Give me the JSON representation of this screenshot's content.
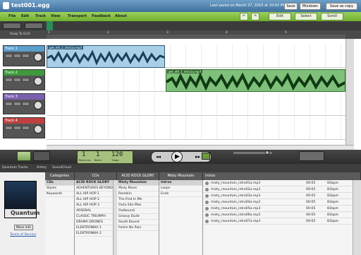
{
  "window": {
    "title": "test001.egg",
    "last_saved": "Last saved on March 27, 2010 at 10:42 PM"
  },
  "window_buttons": {
    "save": "Save",
    "mixdown": "Mixdown",
    "save_as_copy": "Save as copy"
  },
  "menu": {
    "items": [
      "File",
      "Edit",
      "Track",
      "View",
      "Transport",
      "Feedback",
      "About"
    ],
    "edit": "Edit",
    "select": "Select",
    "scroll": "Scroll"
  },
  "ruler": {
    "snap": "Snap To Grid",
    "marks": [
      "1",
      "2",
      "3",
      "4",
      "5"
    ]
  },
  "tracks": [
    {
      "name": "Track 1",
      "color": "#5b9fcf"
    },
    {
      "name": "Track 2",
      "color": "#3d9a3a"
    },
    {
      "name": "Track 3",
      "color": "#7b5fb0"
    },
    {
      "name": "Track 4",
      "color": "#c04040"
    }
  ],
  "clips": [
    {
      "label": "get_eth_2_intro1a.mp3"
    },
    {
      "label": "get_eth_2_intro1a.mp3"
    }
  ],
  "transport": {
    "loop": "Loop",
    "measures": "1",
    "beats": "1",
    "tempo": "120",
    "measures_label": "Measures",
    "beats_label": "Beats",
    "tempo_label": "Tempo"
  },
  "library": {
    "tabs": [
      "Quantum Tracks",
      "Artery",
      "SoundCloud"
    ],
    "categories_header": "Categories",
    "categories": [
      "CDs",
      "Styles",
      "Keywords"
    ],
    "cds_header": "CDs",
    "cds": [
      "ACID ROCK GLORY",
      "ADVENTURES BEYOND",
      "ALL HIP HOP 1",
      "ALL HIP HOP 2",
      "ALL HIP HOP 3",
      "ARSENAL",
      "CLASSIC TRIUMPH",
      "DRAMA DRONES",
      "ELEKTRONIKA 1",
      "ELEKTRONIKA 2"
    ],
    "album_header": "ACID ROCK GLORY",
    "album_items": [
      "Misty Mountain",
      "Misty Music",
      "Ramblin",
      "The Find In Me",
      "Outa Site Man",
      "Outbound",
      "Groovy Dude",
      "South Bound",
      "Feelin No Pain"
    ],
    "song_header": "Misty Mountain",
    "song_items": [
      "Intros",
      "Loops",
      "Ends"
    ],
    "files_header": "Intros",
    "files": [
      {
        "name": "misty_mountain_intro01a.mp3",
        "duration": "00:05",
        "bpm": "81bpm"
      },
      {
        "name": "misty_mountain_intro02a.mp3",
        "duration": "00:05",
        "bpm": "81bpm"
      },
      {
        "name": "misty_mountain_intro03a.mp3",
        "duration": "00:05",
        "bpm": "81bpm"
      },
      {
        "name": "misty_mountain_intro04a.mp3",
        "duration": "00:05",
        "bpm": "81bpm"
      },
      {
        "name": "misty_mountain_intro05a.mp3",
        "duration": "00:05",
        "bpm": "81bpm"
      },
      {
        "name": "misty_mountain_intro06a.mp3",
        "duration": "00:05",
        "bpm": "81bpm"
      },
      {
        "name": "misty_mountain_intro07a.mp3",
        "duration": "00:05",
        "bpm": "81bpm"
      }
    ],
    "brand": "Quantum",
    "more_info": "More Info",
    "terms": "Terms of Service"
  }
}
